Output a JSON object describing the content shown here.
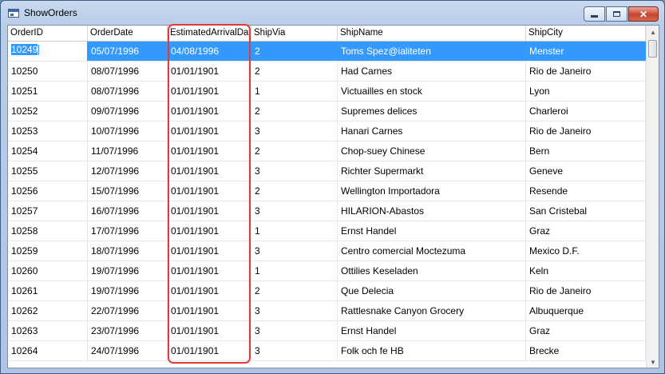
{
  "window": {
    "title": "ShowOrders",
    "minimize_icon": "minimize-icon",
    "maximize_icon": "maximize-icon",
    "close_icon": "close-icon",
    "close_glyph": "✕"
  },
  "grid": {
    "columns": [
      "OrderID",
      "OrderDate",
      "EstimatedArrivalDate",
      "ShipVia",
      "ShipName",
      "ShipCity"
    ],
    "selected_row": 0,
    "editing_value": "10249",
    "rows": [
      [
        "10249",
        "05/07/1996",
        "04/08/1996",
        "2",
        "Toms Spez@ialiteten",
        "Menster"
      ],
      [
        "10250",
        "08/07/1996",
        "01/01/1901",
        "2",
        "Had Carnes",
        "Rio de Janeiro"
      ],
      [
        "10251",
        "08/07/1996",
        "01/01/1901",
        "1",
        "Victuailles en stock",
        "Lyon"
      ],
      [
        "10252",
        "09/07/1996",
        "01/01/1901",
        "2",
        "Supremes delices",
        "Charleroi"
      ],
      [
        "10253",
        "10/07/1996",
        "01/01/1901",
        "3",
        "Hanari Carnes",
        "Rio de Janeiro"
      ],
      [
        "10254",
        "11/07/1996",
        "01/01/1901",
        "2",
        "Chop-suey Chinese",
        "Bern"
      ],
      [
        "10255",
        "12/07/1996",
        "01/01/1901",
        "3",
        "Richter Supermarkt",
        "Geneve"
      ],
      [
        "10256",
        "15/07/1996",
        "01/01/1901",
        "2",
        "Wellington Importadora",
        "Resende"
      ],
      [
        "10257",
        "16/07/1996",
        "01/01/1901",
        "3",
        "HILARION-Abastos",
        "San Cristebal"
      ],
      [
        "10258",
        "17/07/1996",
        "01/01/1901",
        "1",
        "Ernst Handel",
        "Graz"
      ],
      [
        "10259",
        "18/07/1996",
        "01/01/1901",
        "3",
        "Centro comercial Moctezuma",
        "Mexico D.F."
      ],
      [
        "10260",
        "19/07/1996",
        "01/01/1901",
        "1",
        "Ottilies Keseladen",
        "Keln"
      ],
      [
        "10261",
        "19/07/1996",
        "01/01/1901",
        "2",
        "Que Delecia",
        "Rio de Janeiro"
      ],
      [
        "10262",
        "22/07/1996",
        "01/01/1901",
        "3",
        "Rattlesnake Canyon Grocery",
        "Albuquerque"
      ],
      [
        "10263",
        "23/07/1996",
        "01/01/1901",
        "3",
        "Ernst Handel",
        "Graz"
      ],
      [
        "10264",
        "24/07/1996",
        "01/01/1901",
        "3",
        "Folk och fe HB",
        "Brecke"
      ]
    ]
  },
  "scrollbar": {
    "up_glyph": "▲",
    "down_glyph": "▼"
  },
  "colors": {
    "selection": "#3399ff",
    "highlight": "#e23a3a"
  }
}
